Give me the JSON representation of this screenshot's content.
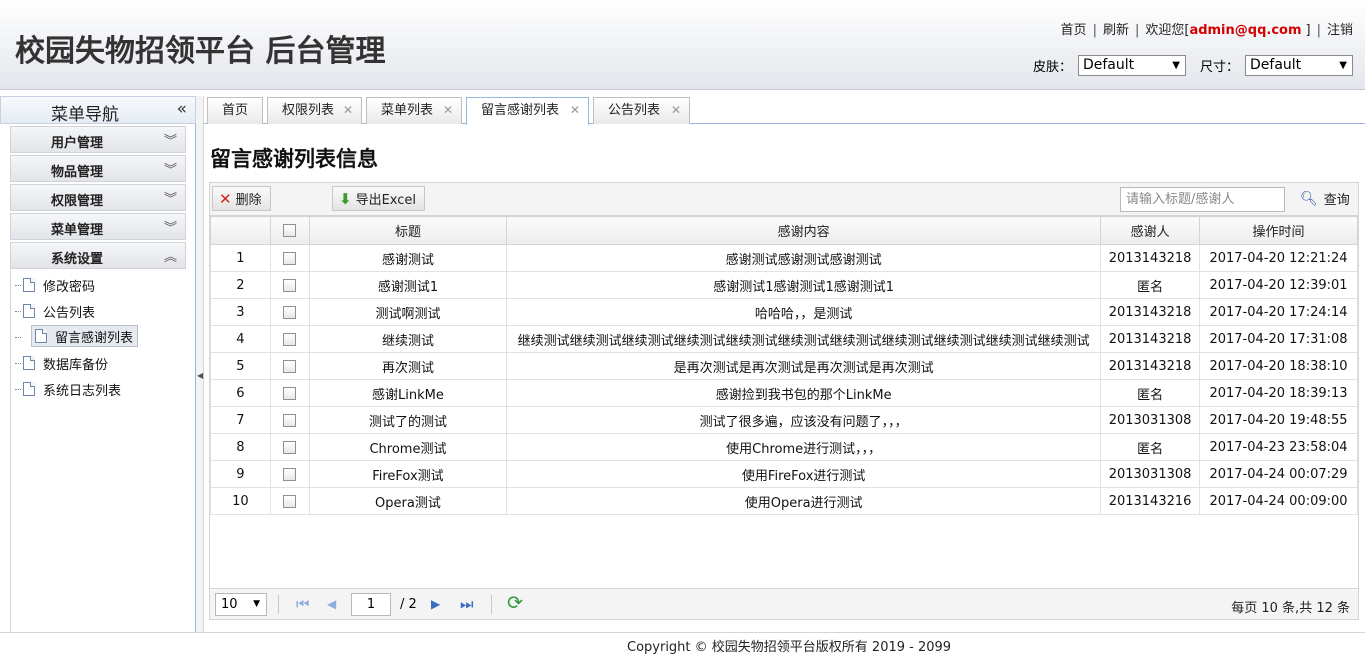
{
  "header": {
    "title": "校园失物招领平台 后台管理",
    "links": {
      "home": "首页",
      "refresh": "刷新",
      "welcome_prefix": "欢迎您[",
      "user": "admin@qq.com",
      "welcome_suffix": "]",
      "logout": "注销"
    },
    "skin_label": "皮肤：",
    "skin_value": "Default",
    "size_label": "尺寸：",
    "size_value": "Default"
  },
  "sidebar": {
    "title": "菜单导航",
    "groups": [
      "用户管理",
      "物品管理",
      "权限管理",
      "菜单管理",
      "系统设置"
    ],
    "items": [
      "修改密码",
      "公告列表",
      "留言感谢列表",
      "数据库备份",
      "系统日志列表"
    ],
    "active_item": "留言感谢列表"
  },
  "tabs": [
    "首页",
    "权限列表",
    "菜单列表",
    "留言感谢列表",
    "公告列表"
  ],
  "main": {
    "title": "留言感谢列表信息",
    "toolbar": {
      "delete": "删除",
      "export": "导出Excel",
      "search_placeholder": "请输入标题/感谢人",
      "search": "查询"
    },
    "columns": [
      "标题",
      "感谢内容",
      "感谢人",
      "操作时间"
    ],
    "rows": [
      [
        "1",
        "感谢测试",
        "感谢测试感谢测试感谢测试",
        "2013143218",
        "2017-04-20 12:21:24"
      ],
      [
        "2",
        "感谢测试1",
        "感谢测试1感谢测试1感谢测试1",
        "匿名",
        "2017-04-20 12:39:01"
      ],
      [
        "3",
        "测试啊测试",
        "哈哈哈，，是测试",
        "2013143218",
        "2017-04-20 17:24:14"
      ],
      [
        "4",
        "继续测试",
        "继续测试继续测试继续测试继续测试继续测试继续测试继续测试继续测试继续测试继续测试继续测试",
        "2013143218",
        "2017-04-20 17:31:08"
      ],
      [
        "5",
        "再次测试",
        "是再次测试是再次测试是再次测试是再次测试",
        "2013143218",
        "2017-04-20 18:38:10"
      ],
      [
        "6",
        "感谢LinkMe",
        "感谢捡到我书包的那个LinkMe",
        "匿名",
        "2017-04-20 18:39:13"
      ],
      [
        "7",
        "测试了的测试",
        "测试了很多遍，应该没有问题了，，，",
        "2013031308",
        "2017-04-20 19:48:55"
      ],
      [
        "8",
        "Chrome测试",
        "使用Chrome进行测试，，，",
        "匿名",
        "2017-04-23 23:58:04"
      ],
      [
        "9",
        "FireFox测试",
        "使用FireFox进行测试",
        "2013031308",
        "2017-04-24 00:07:29"
      ],
      [
        "10",
        "Opera测试",
        "使用Opera进行测试",
        "2013143216",
        "2017-04-24 00:09:00"
      ]
    ],
    "pager": {
      "page_size": "10",
      "page": "1",
      "total_pages": "/ 2",
      "info": "每页 10 条,共 12 条"
    }
  },
  "footer": {
    "copyright": "Copyright © 校园失物招领平台版权所有  2019 - 2099"
  }
}
